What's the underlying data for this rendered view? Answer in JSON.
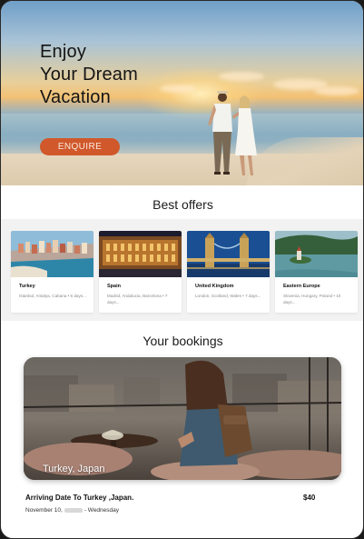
{
  "hero": {
    "title": "Enjoy\nYour Dream\nVacation",
    "cta_label": "ENQUIRE",
    "accent_color": "#d0582a"
  },
  "offers": {
    "heading": "Best offers",
    "items": [
      {
        "name": "Turkey",
        "description": "Istanbul, Antalya, Cabana • 6 days..."
      },
      {
        "name": "Spain",
        "description": "Madrid, Andalucia, Barcelona • 7 days..."
      },
      {
        "name": "United Kingdom",
        "description": "London, Scotland, Wales • 7 days..."
      },
      {
        "name": "Eastern Europe",
        "description": "Slovenia, Hungary, Poland • 10 days..."
      }
    ]
  },
  "bookings": {
    "heading": "Your bookings",
    "card_label": "Turkey, Japan",
    "title": "Arriving Date To Turkey ,Japan.",
    "price": "$40",
    "date_prefix": "November 10,",
    "date_suffix": "- Wednesday"
  }
}
